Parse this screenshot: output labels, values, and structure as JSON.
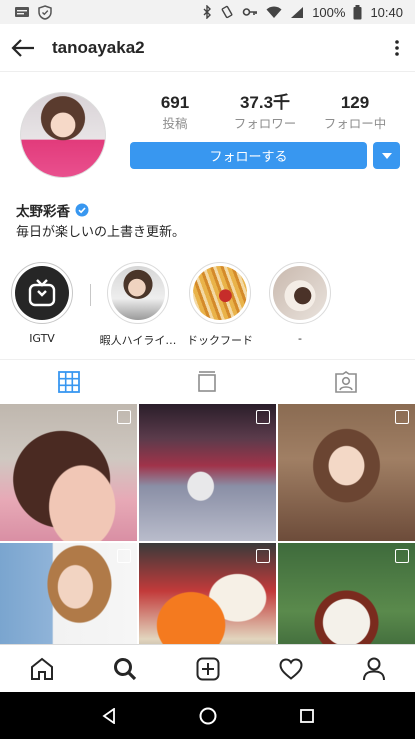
{
  "status_bar": {
    "battery": "100%",
    "time": "10:40"
  },
  "header": {
    "username": "tanoayaka2"
  },
  "profile": {
    "stats": [
      {
        "value": "691",
        "label": "投稿"
      },
      {
        "value": "37.3千",
        "label": "フォロワー"
      },
      {
        "value": "129",
        "label": "フォロー中"
      }
    ],
    "follow_label": "フォローする",
    "name": "太野彩香",
    "bio": "毎日が楽しいの上書き更新。"
  },
  "highlights": [
    {
      "label": "IGTV"
    },
    {
      "label": "暇人ハイライ…"
    },
    {
      "label": "ドックフード"
    },
    {
      "label": "-"
    }
  ],
  "colors": {
    "accent": "#3897f0",
    "verified": "#3897f0"
  }
}
